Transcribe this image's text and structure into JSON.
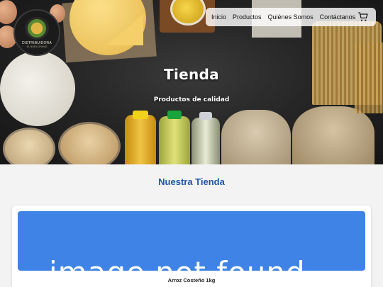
{
  "brand": {
    "name": "DISTRIBUIDORA",
    "tagline": "EL BUEN GRANO"
  },
  "nav": {
    "items": [
      "Inicio",
      "Productos",
      "Quiénes Somos",
      "Contáctanos"
    ],
    "cart_icon": "cart-icon"
  },
  "hero": {
    "title": "Tienda",
    "subtitle": "Productos de calidad"
  },
  "section": {
    "title": "Nuestra Tienda"
  },
  "product": {
    "image_alt": "image not found",
    "name": "Arroz Costeño 1kg"
  },
  "colors": {
    "accent": "#1e55a8",
    "image_placeholder": "#3f83e6"
  }
}
